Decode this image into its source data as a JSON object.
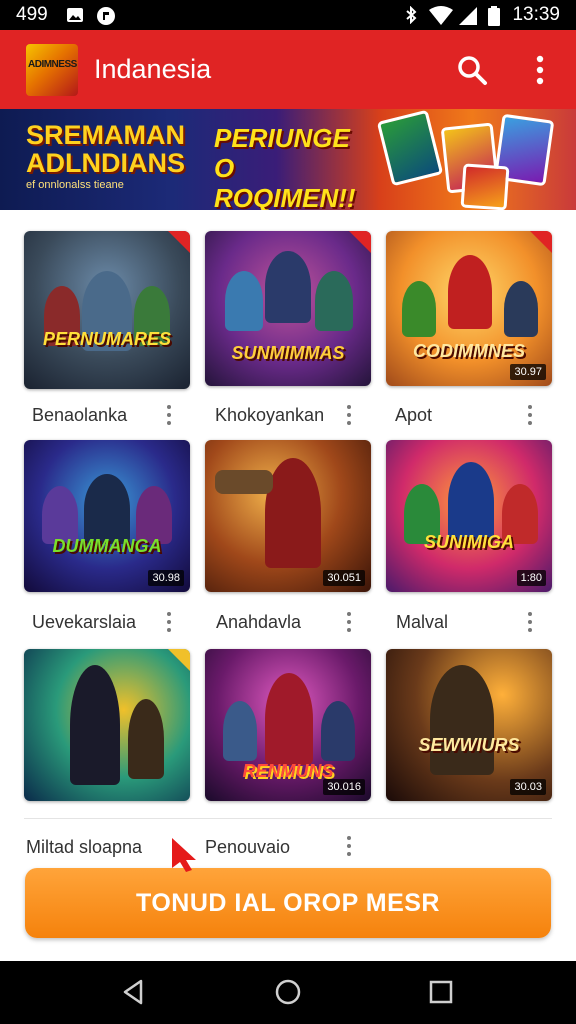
{
  "status_bar": {
    "time_left": "499",
    "time_right": "13:39",
    "icons": [
      "image-icon",
      "notification-icon",
      "bluetooth-icon",
      "wifi-icon",
      "signal-icon",
      "battery-icon"
    ]
  },
  "app_bar": {
    "logo_text": "ADIMNESS",
    "title": "Indanesia",
    "icons": [
      "search-icon",
      "more-vert-icon"
    ]
  },
  "banner": {
    "left_headline": "SREMAMAN ADLNDIANS",
    "left_subline": "ef onnlonalss tieane",
    "mid_headline": "PERIUNGE O ROQIMEN!!"
  },
  "grid": {
    "items": [
      {
        "label": "Benaolanka",
        "art_title": "PERNUMARES",
        "count": ""
      },
      {
        "label": "Khokoyankan",
        "art_title": "SUNMIMMAS",
        "count": ""
      },
      {
        "label": "Apot",
        "art_title": "CODIMMNES",
        "count": "30.97"
      },
      {
        "label": "Uevekarslaia",
        "art_title": "DUMMANGA",
        "count": "30.98"
      },
      {
        "label": "Anahdavla",
        "art_title": "",
        "count": "30.051"
      },
      {
        "label": "Malval",
        "art_title": "SUNIMIGA",
        "count": "1:80"
      },
      {
        "label": "Miltad sloapna",
        "art_title": "",
        "count": ""
      },
      {
        "label": "Penouvaio",
        "art_title": "RENMUNS",
        "count": "30.016"
      },
      {
        "label": "",
        "art_title": "SEWWIURS",
        "count": "30.03"
      }
    ]
  },
  "cta": {
    "label": "TONUD IAL OROP MESR"
  },
  "nav_bar": {
    "icons": [
      "back-icon",
      "home-icon",
      "recents-icon"
    ]
  },
  "colors": {
    "app_bar": "#e02424",
    "cta": "#f5820c",
    "status_bar": "#000000"
  }
}
